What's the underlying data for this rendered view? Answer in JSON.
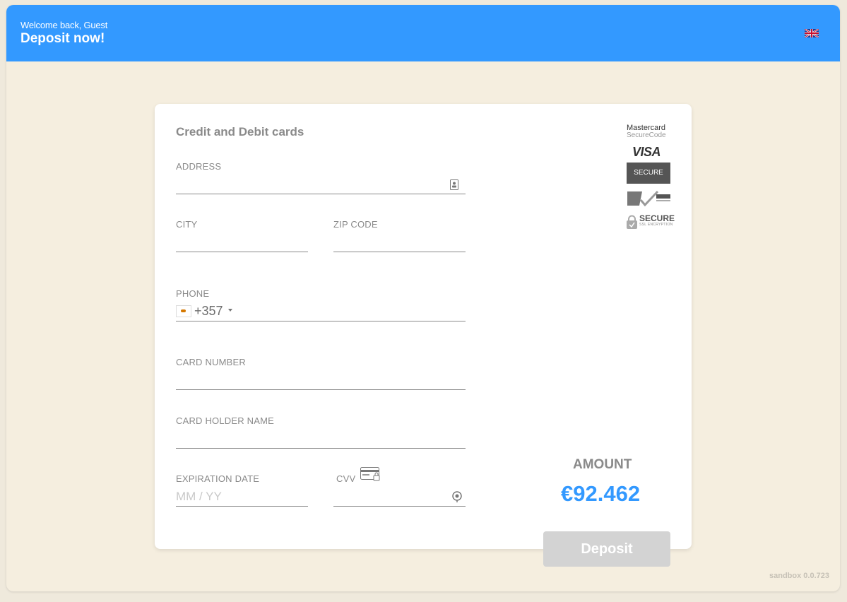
{
  "header": {
    "welcome": "Welcome back, Guest",
    "title": "Deposit now!",
    "language_icon": "uk-flag-icon"
  },
  "form": {
    "title": "Credit and Debit cards",
    "address_label": "ADDRESS",
    "city_label": "CITY",
    "zip_label": "ZIP CODE",
    "phone_label": "PHONE",
    "phone_code": "+357",
    "phone_country_icon": "cyprus-flag-icon",
    "card_number_label": "CARD NUMBER",
    "card_holder_label": "CARD HOLDER NAME",
    "expiry_label": "EXPIRATION DATE",
    "expiry_placeholder": "MM / YY",
    "cvv_label": "CVV"
  },
  "badges": {
    "mastercard_line1": "Mastercard",
    "mastercard_line2": "SecureCode",
    "visa": "VISA",
    "secure": "SECURE",
    "ssl_title": "SECURE",
    "ssl_sub": "SSL ENCRYPTION"
  },
  "amount": {
    "label": "AMOUNT",
    "value": "€92.462"
  },
  "deposit_label": "Deposit",
  "version": "sandbox 0.0.723",
  "colors": {
    "header": "#3399ff",
    "accent": "#3399ff",
    "background": "#f5eedf",
    "button_disabled": "#d3d3d3"
  }
}
